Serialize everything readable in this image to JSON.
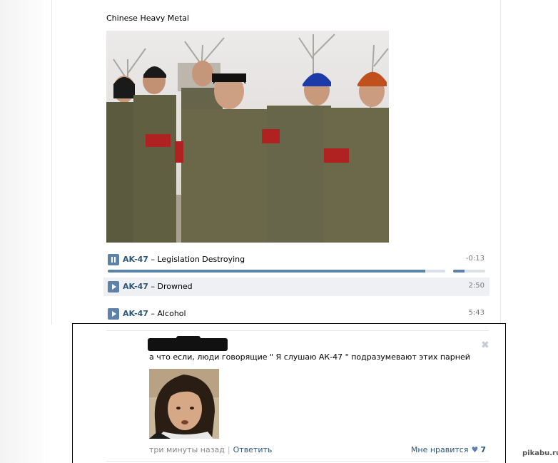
{
  "post": {
    "text": "Chinese Heavy Metal"
  },
  "audio": {
    "tracks": [
      {
        "artist": "AK-47",
        "title": "Legislation Destroying",
        "duration": "-0:13",
        "state": "playing"
      },
      {
        "artist": "AK-47",
        "title": "Drowned",
        "duration": "2:50",
        "state": "paused"
      },
      {
        "artist": "AK-47",
        "title": "Alcohol",
        "duration": "5:43",
        "state": "paused"
      }
    ],
    "progress_fraction": 0.94,
    "volume_fraction": 0.35,
    "dash": "–"
  },
  "comment": {
    "text": "а что если, люди говорящие \" Я слушаю АК-47 \" подразумевают этих парней",
    "time": "три минуты назад",
    "separator": "|",
    "reply_label": "Ответить",
    "like_label": "Мне нравится",
    "like_count": "7",
    "close_icon": "close-icon"
  },
  "watermark": "pikabu.ru",
  "colors": {
    "link": "#2b587a",
    "accent": "#5e81a8",
    "highlight": "#eef0f3"
  }
}
